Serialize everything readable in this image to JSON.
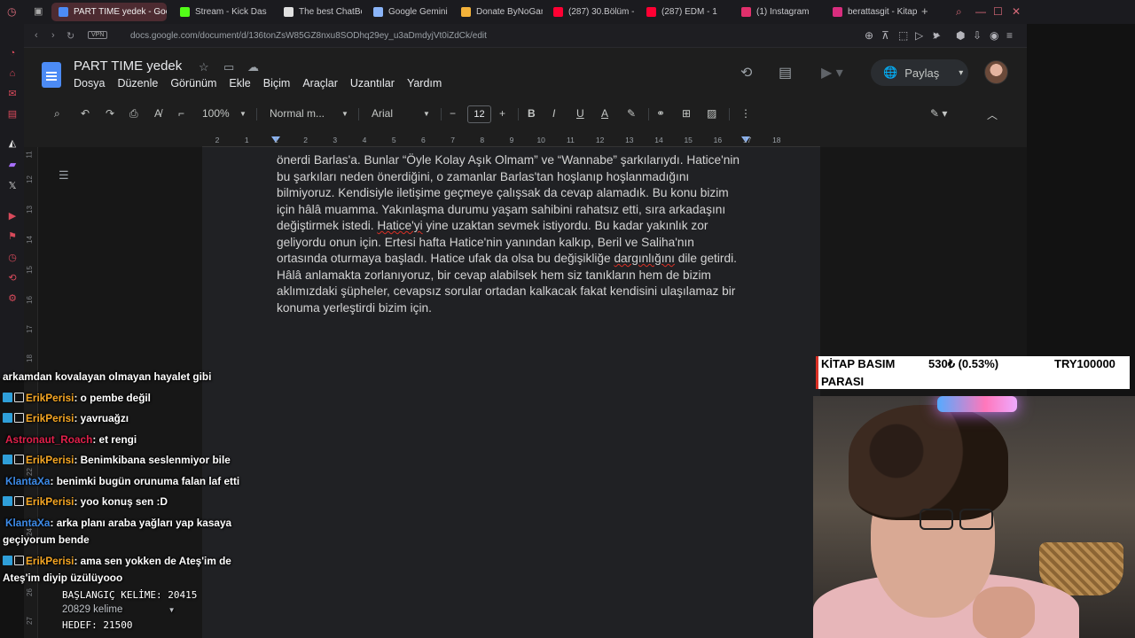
{
  "browser": {
    "tabs": [
      {
        "label": "PART TIME yedek - Goog",
        "color": "#4c8bf5",
        "active": true
      },
      {
        "label": "Stream - Kick Das",
        "color": "#53fc18",
        "active": false
      },
      {
        "label": "The best ChatBot",
        "color": "#e0e0e0",
        "active": false
      },
      {
        "label": "Google Gemini",
        "color": "#8ab4f8",
        "active": false
      },
      {
        "label": "Donate ByNoGam",
        "color": "#f3b23a",
        "active": false
      },
      {
        "label": "(287) 30.Bölüm -",
        "color": "#ff0033",
        "active": false
      },
      {
        "label": "(287) EDM - 1",
        "color": "#ff0033",
        "active": false
      },
      {
        "label": "(1) Instagram",
        "color": "#e1306c",
        "active": false
      },
      {
        "label": "berattasgit - Kitap",
        "color": "#d82d7e",
        "active": false
      }
    ],
    "vpn_label": "VPN",
    "url": "docs.google.com/document/d/136tonZsW85GZ8nxu8SODhq29ey_u3aDmdyjVt0iZdCk/edit"
  },
  "docs": {
    "title": "PART TIME  yedek",
    "menu": [
      "Dosya",
      "Düzenle",
      "Görünüm",
      "Ekle",
      "Biçim",
      "Araçlar",
      "Uzantılar",
      "Yardım"
    ],
    "share_label": "Paylaş",
    "toolbar": {
      "zoom": "100%",
      "style": "Normal m...",
      "font": "Arial",
      "font_size": "12"
    },
    "ruler_ticks": [
      "2",
      "1",
      "1",
      "2",
      "3",
      "4",
      "5",
      "6",
      "7",
      "8",
      "9",
      "10",
      "11",
      "12",
      "13",
      "14",
      "15",
      "16",
      "17",
      "18"
    ],
    "vruler_ticks": [
      "11",
      "12",
      "13",
      "14",
      "15",
      "16",
      "17",
      "18",
      "22",
      "23",
      "24",
      "25",
      "26",
      "27"
    ],
    "paragraph": {
      "p1": "önerdi Barlas'a. Bunlar “Öyle Kolay Aşık Olmam” ve “Wannabe” şarkılarıydı. Hatice'nin bu şarkıları neden önerdiğini, o zamanlar Barlas'tan hoşlanıp hoşlanmadığını bilmiyoruz. Kendisiyle iletişime geçmeye çalışsak da cevap alamadık. Bu konu bizim için hâlâ muamma. Yakınlaşma durumu yaşam sahibini rahatsız etti, sıra arkadaşını değiştirmek istedi. ",
      "w1": "Hatice'yi",
      "p2": " yine uzaktan sevmek istiyordu. Bu kadar yakınlık zor geliyordu onun için. Ertesi hafta Hatice'nin yanından kalkıp, Beril ve Saliha'nın ortasında oturmaya başladı. Hatice ufak da olsa bu değişikliğe ",
      "w2": "dargınlığını",
      "p3": " dile getirdi. Hâlâ anlamakta zorlanıyoruz, bir cevap alabilsek hem siz tanıkların hem de bizim aklımızdaki şüpheler, cevapsız sorular ortadan kalkacak fakat kendisini ulaşılamaz bir konuma yerleştirdi bizim için."
    }
  },
  "chat": {
    "partial_top": "arkamdan kovalayan olmayan hayalet gibi",
    "messages": [
      {
        "user": "ErikPerisi",
        "color": "#f5a623",
        "badges": true,
        "text": ": o pembe değil"
      },
      {
        "user": "ErikPerisi",
        "color": "#f5a623",
        "badges": true,
        "text": ": yavruağzı"
      },
      {
        "user": "Astronaut_Roach",
        "color": "#e0204a",
        "badges": false,
        "text": ": et rengi"
      },
      {
        "user": "ErikPerisi",
        "color": "#f5a623",
        "badges": true,
        "text": ": Benimkibana seslenmiyor bile"
      },
      {
        "user": "KlantaXa",
        "color": "#3d8be8",
        "badges": false,
        "text": ": benimki bugün orunuma falan laf etti"
      },
      {
        "user": "ErikPerisi",
        "color": "#f5a623",
        "badges": true,
        "text": ": yoo konuş sen :D"
      },
      {
        "user": "KlantaXa",
        "color": "#3d8be8",
        "badges": false,
        "text": ": arka planı araba yağları yap kasaya geçiyorum bende"
      },
      {
        "user": "ErikPerisi",
        "color": "#f5a623",
        "badges": true,
        "text": ": ama sen yokken de Ateş'im de Ateş'im diyip üzülüyooo"
      }
    ]
  },
  "counter": {
    "start": "BAŞLANGIÇ KELİME: 20415",
    "word_count": "20829 kelime",
    "target": "HEDEF: 21500"
  },
  "ticker": {
    "label_line1": "KİTAP BASIM",
    "label_line2": "PARASI",
    "value": "530₺ (0.53%)",
    "goal": "TRY100000"
  }
}
